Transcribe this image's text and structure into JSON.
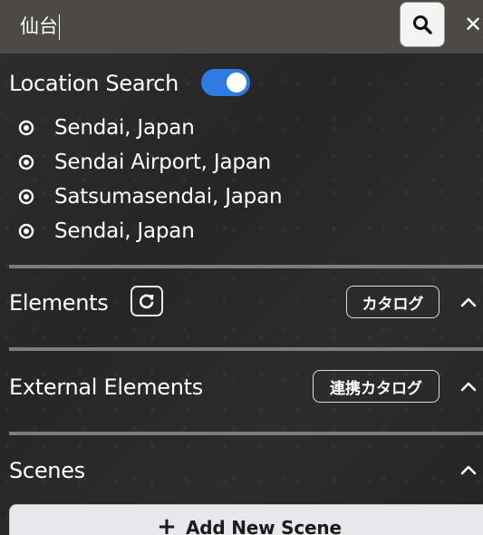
{
  "search": {
    "value": "仙台",
    "close_glyph": "✕",
    "search_icon": "search-icon",
    "close_icon": "close-icon"
  },
  "location_search": {
    "title": "Location Search",
    "toggle_on": true,
    "toggle_color": "#2f7be3",
    "results": [
      {
        "label": "Sendai, Japan"
      },
      {
        "label": "Sendai Airport, Japan"
      },
      {
        "label": "Satsumasendai, Japan"
      },
      {
        "label": "Sendai, Japan"
      }
    ]
  },
  "elements": {
    "title": "Elements",
    "catalog_label": "カタログ",
    "refresh_icon": "refresh-icon",
    "expanded": true
  },
  "external_elements": {
    "title": "External Elements",
    "catalog_label": "連携カタログ",
    "expanded": true
  },
  "scenes": {
    "title": "Scenes",
    "add_plus": "+",
    "add_label": "Add New Scene",
    "expanded": true
  },
  "colors": {
    "search_bar_bg": "#4d4a45",
    "divider": "#7c7c7c",
    "add_button_bg": "#e6e8eb"
  }
}
